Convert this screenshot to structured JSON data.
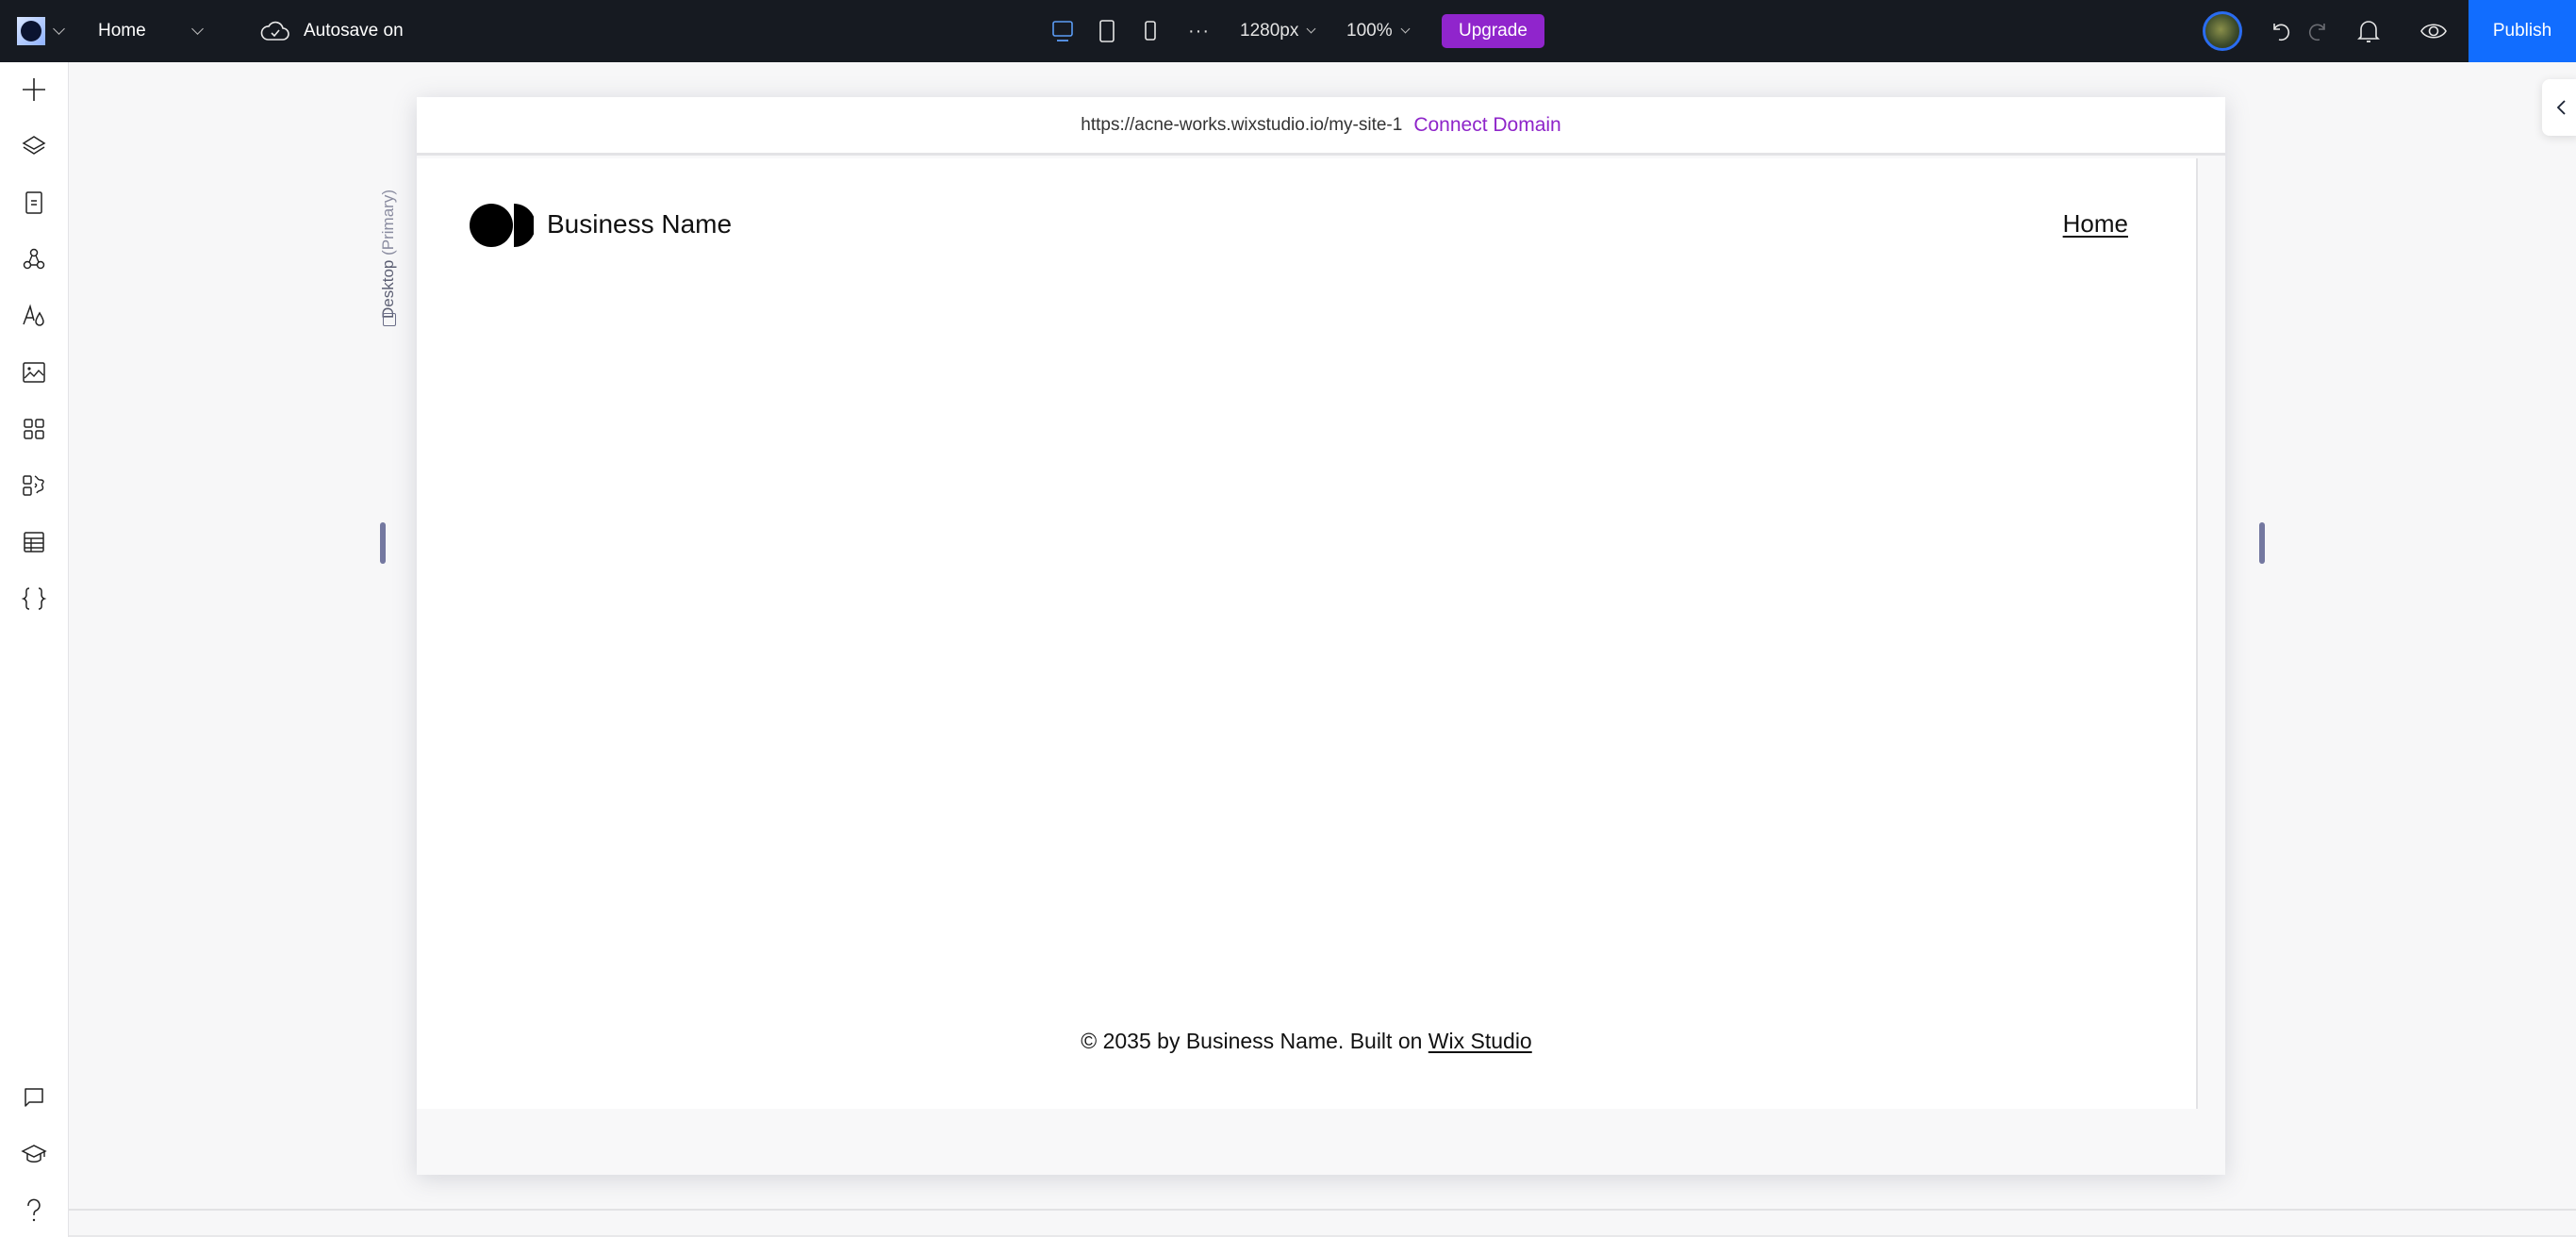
{
  "topbar": {
    "page_selector": "Home",
    "autosave_label": "Autosave on",
    "devices": [
      {
        "name": "desktop",
        "active": true
      },
      {
        "name": "tablet",
        "active": false
      },
      {
        "name": "mobile",
        "active": false
      }
    ],
    "more_label": "···",
    "width_value": "1280px",
    "zoom_value": "100%",
    "upgrade_label": "Upgrade",
    "publish_label": "Publish",
    "colors": {
      "upgrade": "#9025cc",
      "publish": "#116dff",
      "bar": "#161a21"
    }
  },
  "sidebar": {
    "items": [
      {
        "icon": "plus-icon",
        "label": "Add Elements"
      },
      {
        "icon": "layers-icon",
        "label": "Layers"
      },
      {
        "icon": "page-icon",
        "label": "Pages"
      },
      {
        "icon": "components-icon",
        "label": "Components"
      },
      {
        "icon": "typography-icon",
        "label": "Site Styles"
      },
      {
        "icon": "image-icon",
        "label": "Media"
      },
      {
        "icon": "apps-icon",
        "label": "Apps"
      },
      {
        "icon": "add-apps-icon",
        "label": "Add Apps"
      },
      {
        "icon": "table-icon",
        "label": "CMS"
      },
      {
        "icon": "code-braces-icon",
        "label": "Code"
      }
    ],
    "bottom_items": [
      {
        "icon": "chat-icon",
        "label": "Comments"
      },
      {
        "icon": "graduation-cap-icon",
        "label": "Learn"
      },
      {
        "icon": "help-icon",
        "label": "Help"
      }
    ]
  },
  "canvas": {
    "url": "https://acne-works.wixstudio.io/my-site-1",
    "connect_domain_label": "Connect Domain",
    "breakpoint_label": "Desktop",
    "breakpoint_sub": "(Primary)",
    "site": {
      "business_name": "Business Name",
      "nav_home": "Home",
      "footer_text": "© 2035 by Business Name. Built on ",
      "footer_link": "Wix Studio"
    }
  }
}
